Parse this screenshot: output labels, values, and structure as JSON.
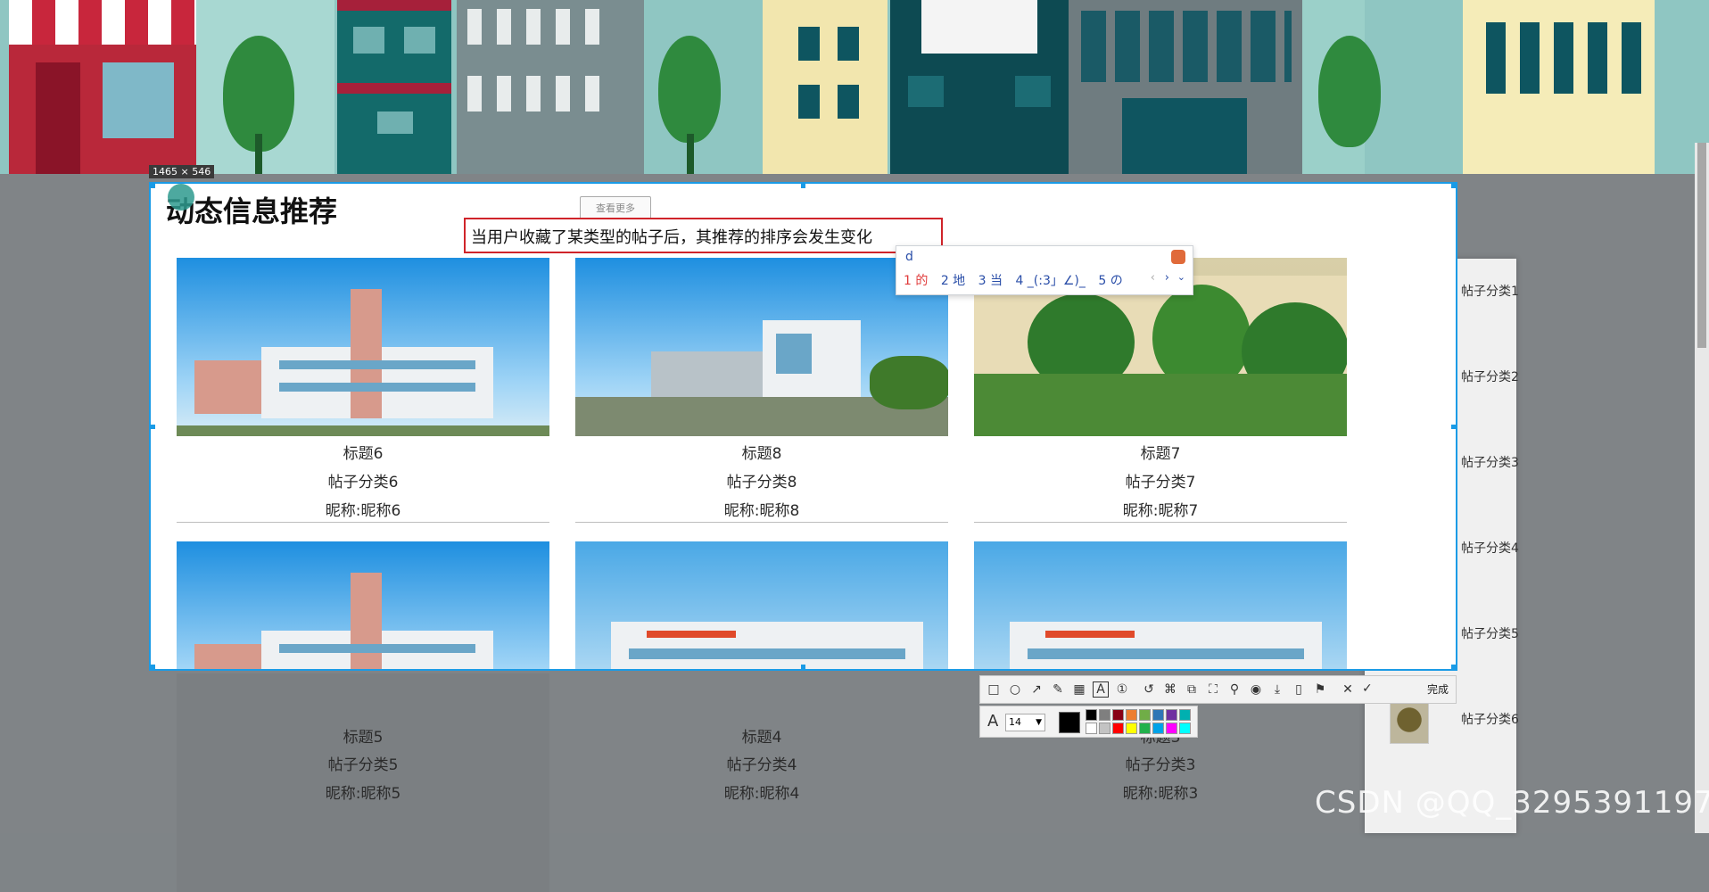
{
  "selection": {
    "size_label": "1465 × 546"
  },
  "section": {
    "title": "动态信息推荐",
    "more_label": "查看更多"
  },
  "input": {
    "value": "当用户收藏了某类型的帖子后，其推荐的排序会发生变化"
  },
  "ime": {
    "typed": "d",
    "candidates": [
      "1 的",
      "2 地",
      "3 当",
      "4 _(:3」∠)_",
      "5 の"
    ]
  },
  "cards": [
    {
      "title": "标题6",
      "category": "帖子分类6",
      "nickname": "昵称:昵称6"
    },
    {
      "title": "标题8",
      "category": "帖子分类8",
      "nickname": "昵称:昵称8"
    },
    {
      "title": "标题7",
      "category": "帖子分类7",
      "nickname": "昵称:昵称7"
    },
    {
      "title": "标题5",
      "category": "帖子分类5",
      "nickname": "昵称:昵称5"
    },
    {
      "title": "标题4",
      "category": "帖子分类4",
      "nickname": "昵称:昵称4"
    },
    {
      "title": "标题3",
      "category": "帖子分类3",
      "nickname": "昵称:昵称3"
    }
  ],
  "sidebar": {
    "items": [
      {
        "label": "帖子分类1"
      },
      {
        "label": "帖子分类2"
      },
      {
        "label": "帖子分类3"
      },
      {
        "label": "帖子分类4"
      },
      {
        "label": "帖子分类5"
      },
      {
        "label": "帖子分类6"
      }
    ]
  },
  "toolbar": {
    "done_label": "完成",
    "icons": [
      "rectangle-icon",
      "ellipse-icon",
      "arrow-icon",
      "pen-icon",
      "mosaic-icon",
      "text-icon",
      "number-icon",
      "undo-icon",
      "ocr-icon",
      "copy-icon",
      "scan-icon",
      "pin-icon",
      "record-icon",
      "download-icon",
      "phone-icon",
      "bookmark-icon",
      "close-icon"
    ],
    "font_size": "14",
    "font_label": "A",
    "current_color": "#000000",
    "palette": [
      "#000000",
      "#7f7f7f",
      "#880015",
      "#ed7d31",
      "#70ad47",
      "#2e75b6",
      "#7030a0",
      "#00b0b0",
      "#ffffff",
      "#c3c3c3",
      "#ff0000",
      "#ffff00",
      "#22b14c",
      "#00a2e8",
      "#ff00ff",
      "#00ffff"
    ]
  },
  "watermark": "CSDN @QQ_3295391197"
}
